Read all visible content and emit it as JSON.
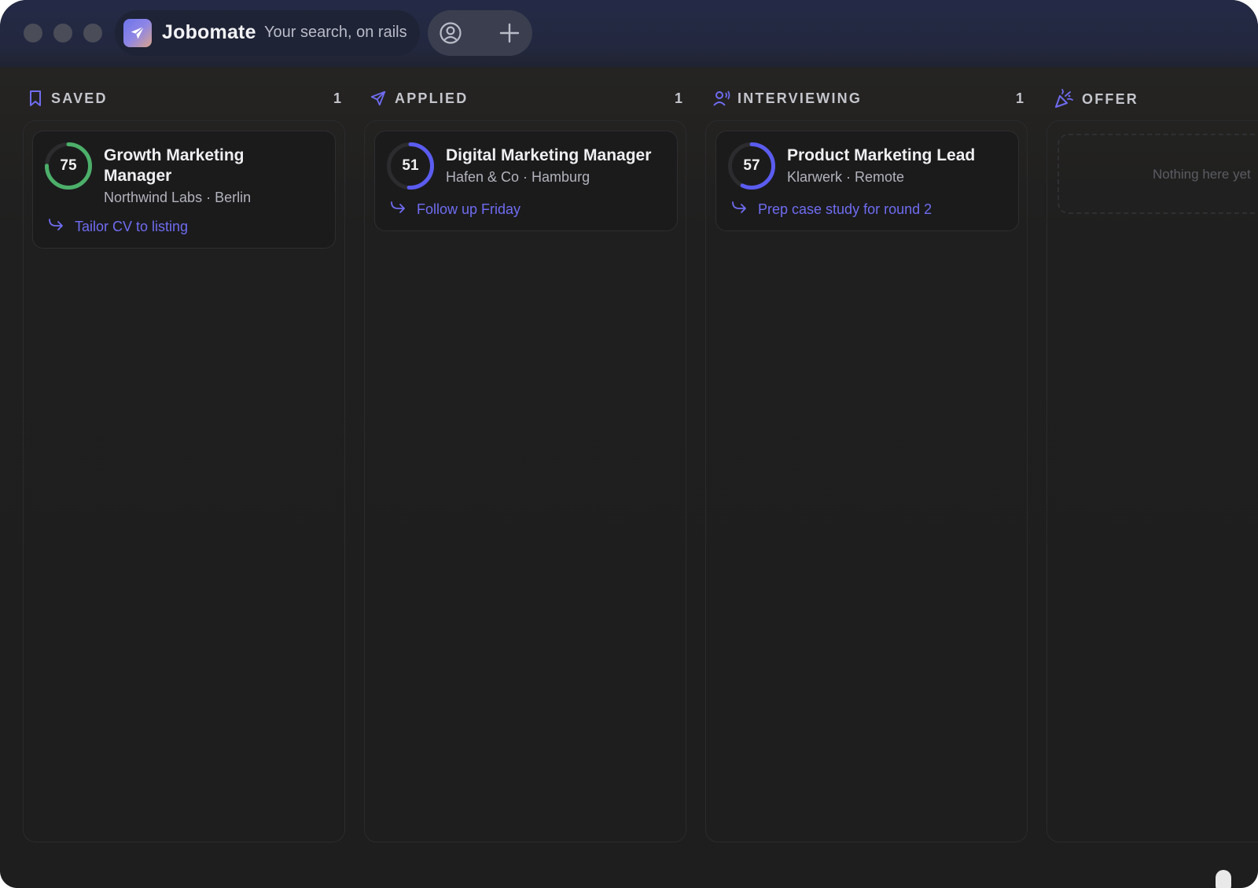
{
  "app": {
    "name": "Jobomate",
    "tagline": "Your search, on rails",
    "logo_icon": "paper-plane-icon",
    "profile_icon": "user-circle-icon",
    "add_icon": "plus-icon"
  },
  "colors": {
    "accent": "#6f6cf0",
    "score_high": "#4caf6a",
    "score_mid": "#5b5cf0"
  },
  "columns": [
    {
      "title": "SAVED",
      "count": "1",
      "icon": "bookmark-icon",
      "cards": [
        {
          "score": "75",
          "score_value": 75,
          "title_line1": "Growth Marketing",
          "title_line2": "Manager",
          "meta": "Northwind Labs · Berlin",
          "next_step": "Tailor CV to listing"
        }
      ]
    },
    {
      "title": "APPLIED",
      "count": "1",
      "icon": "send-icon",
      "cards": [
        {
          "score": "51",
          "score_value": 51,
          "title_line1": "Digital Marketing Manager",
          "meta": "Hafen & Co · Hamburg",
          "next_step": "Follow up Friday"
        }
      ]
    },
    {
      "title": "INTERVIEWING",
      "count": "1",
      "icon": "user-voice-icon",
      "cards": [
        {
          "score": "57",
          "score_value": 57,
          "title_line1": "Product Marketing Lead",
          "meta": "Klarwerk · Remote",
          "next_step": "Prep case study for round 2"
        }
      ]
    },
    {
      "title": "OFFER",
      "icon": "party-popper-icon",
      "empty_text": "Nothing here yet",
      "cards": []
    }
  ]
}
